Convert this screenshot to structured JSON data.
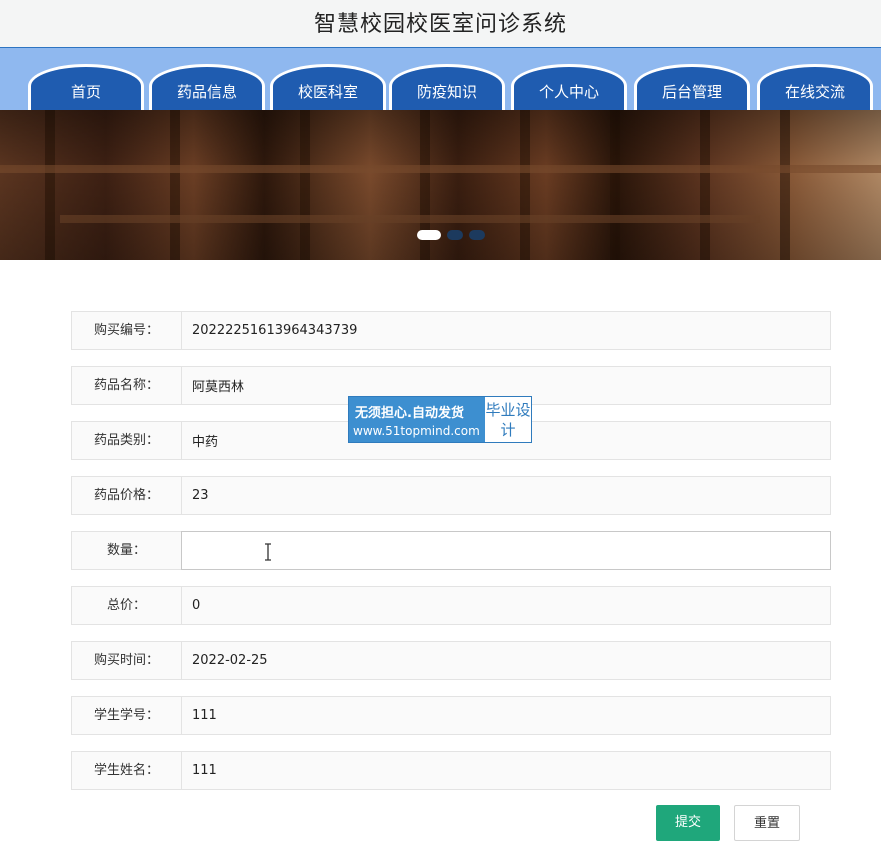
{
  "header": {
    "title": "智慧校园校医室问诊系统"
  },
  "nav": {
    "items": [
      "首页",
      "药品信息",
      "校医科室",
      "防疫知识",
      "个人中心",
      "后台管理",
      "在线交流"
    ]
  },
  "carousel": {
    "active_index": 0,
    "count": 3
  },
  "form": {
    "purchase_no_label": "购买编号：",
    "purchase_no_value": "20222251613964343739",
    "drug_name_label": "药品名称：",
    "drug_name_value": "阿莫西林",
    "drug_category_label": "药品类别：",
    "drug_category_value": "中药",
    "drug_price_label": "药品价格：",
    "drug_price_value": "23",
    "quantity_label": "数量：",
    "quantity_value": "",
    "total_label": "总价：",
    "total_value": "0",
    "purchase_time_label": "购买时间：",
    "purchase_time_value": "2022-02-25",
    "student_no_label": "学生学号：",
    "student_no_value": "111",
    "student_name_label": "学生姓名：",
    "student_name_value": "111"
  },
  "buttons": {
    "submit": "提交",
    "reset": "重置"
  },
  "watermark": {
    "line1": "无须担心.自动发货",
    "line2": "www.51topmind.com",
    "badge": "毕业设计"
  },
  "colors": {
    "nav_tab": "#1f5cb0",
    "nav_bg": "#8fb8ef",
    "submit": "#1fa77b"
  }
}
